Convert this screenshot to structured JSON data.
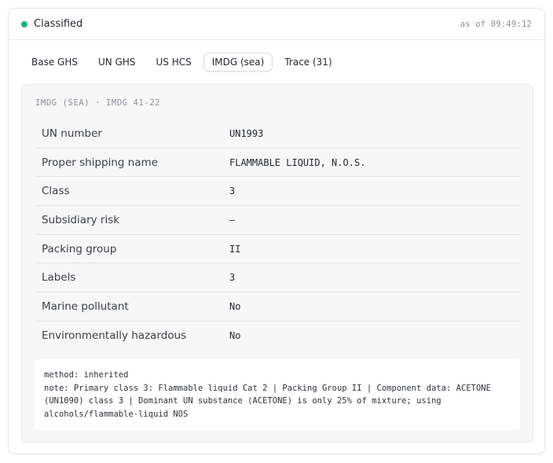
{
  "header": {
    "status_label": "Classified",
    "status_color": "#22b07d",
    "timestamp": "as of 09:49:12"
  },
  "tabs": [
    {
      "label": "Base GHS",
      "active": false
    },
    {
      "label": "UN GHS",
      "active": false
    },
    {
      "label": "US HCS",
      "active": false
    },
    {
      "label": "IMDG (sea)",
      "active": true
    },
    {
      "label": "Trace (31)",
      "active": false
    }
  ],
  "panel": {
    "title": "IMDG (SEA) · IMDG 41-22",
    "rows": [
      {
        "label": "UN number",
        "value": "UN1993"
      },
      {
        "label": "Proper shipping name",
        "value": "FLAMMABLE LIQUID, N.O.S."
      },
      {
        "label": "Class",
        "value": "3"
      },
      {
        "label": "Subsidiary risk",
        "value": "—"
      },
      {
        "label": "Packing group",
        "value": "II"
      },
      {
        "label": "Labels",
        "value": "3"
      },
      {
        "label": "Marine pollutant",
        "value": "No"
      },
      {
        "label": "Environmentally hazardous",
        "value": "No"
      }
    ],
    "notes": {
      "method": "method: inherited",
      "note": "note: Primary class 3: Flammable liquid Cat 2 | Packing Group II | Component data: ACETONE (UN1090) class 3 | Dominant UN substance (ACETONE) is only 25% of mixture; using alcohols/flammable-liquid NOS"
    }
  }
}
